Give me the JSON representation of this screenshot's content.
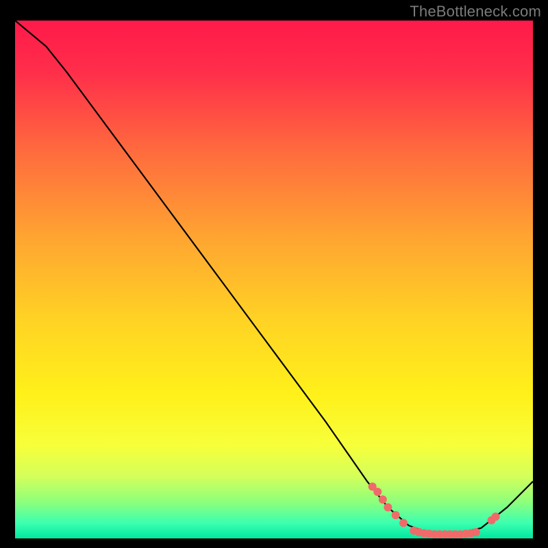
{
  "watermark": "TheBottleneck.com",
  "chart_data": {
    "type": "line",
    "title": "",
    "xlabel": "",
    "ylabel": "",
    "xlim": [
      0,
      100
    ],
    "ylim": [
      0,
      100
    ],
    "curve": [
      {
        "x": 0,
        "y": 100
      },
      {
        "x": 6,
        "y": 95
      },
      {
        "x": 10,
        "y": 90
      },
      {
        "x": 20,
        "y": 76.5
      },
      {
        "x": 30,
        "y": 63
      },
      {
        "x": 40,
        "y": 49.5
      },
      {
        "x": 50,
        "y": 36
      },
      {
        "x": 60,
        "y": 22.5
      },
      {
        "x": 68,
        "y": 11
      },
      {
        "x": 72,
        "y": 6
      },
      {
        "x": 76,
        "y": 2.5
      },
      {
        "x": 80,
        "y": 1
      },
      {
        "x": 85,
        "y": 0.8
      },
      {
        "x": 90,
        "y": 2
      },
      {
        "x": 95,
        "y": 6
      },
      {
        "x": 100,
        "y": 11
      }
    ],
    "markers": [
      {
        "x": 69,
        "y": 10
      },
      {
        "x": 70,
        "y": 9
      },
      {
        "x": 71,
        "y": 7.5
      },
      {
        "x": 72,
        "y": 6
      },
      {
        "x": 73.5,
        "y": 4.5
      },
      {
        "x": 75,
        "y": 3
      },
      {
        "x": 77,
        "y": 1.5
      },
      {
        "x": 78,
        "y": 1.2
      },
      {
        "x": 79,
        "y": 1.0
      },
      {
        "x": 80,
        "y": 0.9
      },
      {
        "x": 81,
        "y": 0.8
      },
      {
        "x": 82,
        "y": 0.8
      },
      {
        "x": 83,
        "y": 0.8
      },
      {
        "x": 84,
        "y": 0.8
      },
      {
        "x": 85,
        "y": 0.8
      },
      {
        "x": 86,
        "y": 0.8
      },
      {
        "x": 87,
        "y": 0.9
      },
      {
        "x": 88,
        "y": 1.0
      },
      {
        "x": 89,
        "y": 1.2
      },
      {
        "x": 92,
        "y": 3.5
      },
      {
        "x": 92.8,
        "y": 4.2
      }
    ],
    "gradient_stops": [
      {
        "offset": 0.0,
        "color": "#ff1a4a"
      },
      {
        "offset": 0.1,
        "color": "#ff2e4a"
      },
      {
        "offset": 0.25,
        "color": "#ff6a3e"
      },
      {
        "offset": 0.42,
        "color": "#ffa531"
      },
      {
        "offset": 0.58,
        "color": "#ffd324"
      },
      {
        "offset": 0.72,
        "color": "#fff01a"
      },
      {
        "offset": 0.82,
        "color": "#f7ff3a"
      },
      {
        "offset": 0.88,
        "color": "#d4ff5a"
      },
      {
        "offset": 0.93,
        "color": "#8dff7c"
      },
      {
        "offset": 0.97,
        "color": "#3dffb0"
      },
      {
        "offset": 1.0,
        "color": "#00e8a0"
      }
    ],
    "marker_color": "#f06a6a",
    "line_color": "#000000"
  }
}
